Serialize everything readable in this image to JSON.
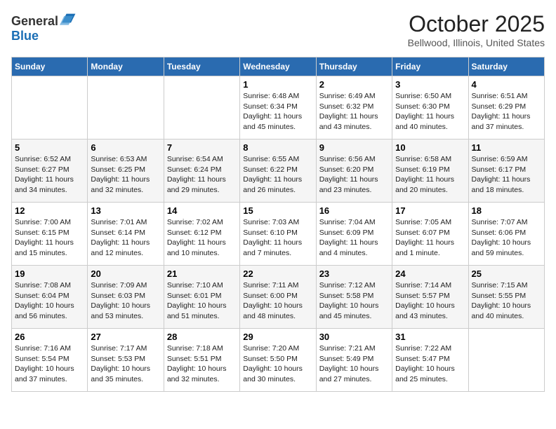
{
  "header": {
    "logo_line1": "General",
    "logo_line2": "Blue",
    "month_title": "October 2025",
    "location": "Bellwood, Illinois, United States"
  },
  "days_of_week": [
    "Sunday",
    "Monday",
    "Tuesday",
    "Wednesday",
    "Thursday",
    "Friday",
    "Saturday"
  ],
  "weeks": [
    [
      {
        "day": "",
        "content": ""
      },
      {
        "day": "",
        "content": ""
      },
      {
        "day": "",
        "content": ""
      },
      {
        "day": "1",
        "content": "Sunrise: 6:48 AM\nSunset: 6:34 PM\nDaylight: 11 hours and 45 minutes."
      },
      {
        "day": "2",
        "content": "Sunrise: 6:49 AM\nSunset: 6:32 PM\nDaylight: 11 hours and 43 minutes."
      },
      {
        "day": "3",
        "content": "Sunrise: 6:50 AM\nSunset: 6:30 PM\nDaylight: 11 hours and 40 minutes."
      },
      {
        "day": "4",
        "content": "Sunrise: 6:51 AM\nSunset: 6:29 PM\nDaylight: 11 hours and 37 minutes."
      }
    ],
    [
      {
        "day": "5",
        "content": "Sunrise: 6:52 AM\nSunset: 6:27 PM\nDaylight: 11 hours and 34 minutes."
      },
      {
        "day": "6",
        "content": "Sunrise: 6:53 AM\nSunset: 6:25 PM\nDaylight: 11 hours and 32 minutes."
      },
      {
        "day": "7",
        "content": "Sunrise: 6:54 AM\nSunset: 6:24 PM\nDaylight: 11 hours and 29 minutes."
      },
      {
        "day": "8",
        "content": "Sunrise: 6:55 AM\nSunset: 6:22 PM\nDaylight: 11 hours and 26 minutes."
      },
      {
        "day": "9",
        "content": "Sunrise: 6:56 AM\nSunset: 6:20 PM\nDaylight: 11 hours and 23 minutes."
      },
      {
        "day": "10",
        "content": "Sunrise: 6:58 AM\nSunset: 6:19 PM\nDaylight: 11 hours and 20 minutes."
      },
      {
        "day": "11",
        "content": "Sunrise: 6:59 AM\nSunset: 6:17 PM\nDaylight: 11 hours and 18 minutes."
      }
    ],
    [
      {
        "day": "12",
        "content": "Sunrise: 7:00 AM\nSunset: 6:15 PM\nDaylight: 11 hours and 15 minutes."
      },
      {
        "day": "13",
        "content": "Sunrise: 7:01 AM\nSunset: 6:14 PM\nDaylight: 11 hours and 12 minutes."
      },
      {
        "day": "14",
        "content": "Sunrise: 7:02 AM\nSunset: 6:12 PM\nDaylight: 11 hours and 10 minutes."
      },
      {
        "day": "15",
        "content": "Sunrise: 7:03 AM\nSunset: 6:10 PM\nDaylight: 11 hours and 7 minutes."
      },
      {
        "day": "16",
        "content": "Sunrise: 7:04 AM\nSunset: 6:09 PM\nDaylight: 11 hours and 4 minutes."
      },
      {
        "day": "17",
        "content": "Sunrise: 7:05 AM\nSunset: 6:07 PM\nDaylight: 11 hours and 1 minute."
      },
      {
        "day": "18",
        "content": "Sunrise: 7:07 AM\nSunset: 6:06 PM\nDaylight: 10 hours and 59 minutes."
      }
    ],
    [
      {
        "day": "19",
        "content": "Sunrise: 7:08 AM\nSunset: 6:04 PM\nDaylight: 10 hours and 56 minutes."
      },
      {
        "day": "20",
        "content": "Sunrise: 7:09 AM\nSunset: 6:03 PM\nDaylight: 10 hours and 53 minutes."
      },
      {
        "day": "21",
        "content": "Sunrise: 7:10 AM\nSunset: 6:01 PM\nDaylight: 10 hours and 51 minutes."
      },
      {
        "day": "22",
        "content": "Sunrise: 7:11 AM\nSunset: 6:00 PM\nDaylight: 10 hours and 48 minutes."
      },
      {
        "day": "23",
        "content": "Sunrise: 7:12 AM\nSunset: 5:58 PM\nDaylight: 10 hours and 45 minutes."
      },
      {
        "day": "24",
        "content": "Sunrise: 7:14 AM\nSunset: 5:57 PM\nDaylight: 10 hours and 43 minutes."
      },
      {
        "day": "25",
        "content": "Sunrise: 7:15 AM\nSunset: 5:55 PM\nDaylight: 10 hours and 40 minutes."
      }
    ],
    [
      {
        "day": "26",
        "content": "Sunrise: 7:16 AM\nSunset: 5:54 PM\nDaylight: 10 hours and 37 minutes."
      },
      {
        "day": "27",
        "content": "Sunrise: 7:17 AM\nSunset: 5:53 PM\nDaylight: 10 hours and 35 minutes."
      },
      {
        "day": "28",
        "content": "Sunrise: 7:18 AM\nSunset: 5:51 PM\nDaylight: 10 hours and 32 minutes."
      },
      {
        "day": "29",
        "content": "Sunrise: 7:20 AM\nSunset: 5:50 PM\nDaylight: 10 hours and 30 minutes."
      },
      {
        "day": "30",
        "content": "Sunrise: 7:21 AM\nSunset: 5:49 PM\nDaylight: 10 hours and 27 minutes."
      },
      {
        "day": "31",
        "content": "Sunrise: 7:22 AM\nSunset: 5:47 PM\nDaylight: 10 hours and 25 minutes."
      },
      {
        "day": "",
        "content": ""
      }
    ]
  ]
}
